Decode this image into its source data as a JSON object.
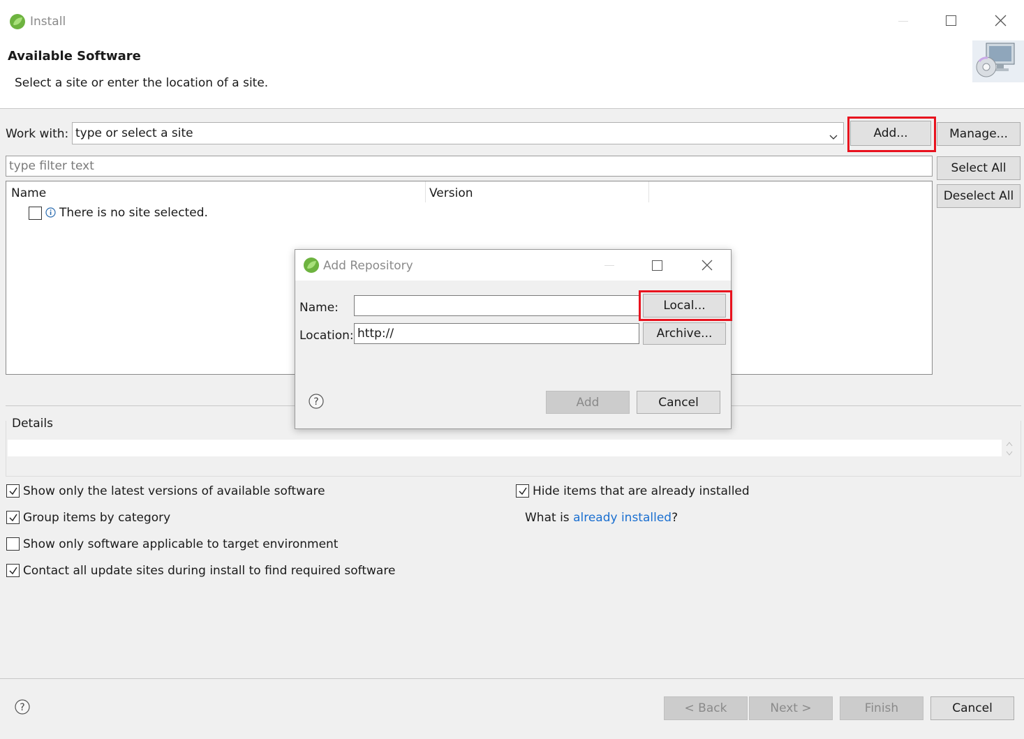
{
  "window": {
    "title": "Install",
    "icon": "spring-leaf-icon"
  },
  "header": {
    "title": "Available Software",
    "subtitle": "Select a site or enter the location of a site."
  },
  "work_with": {
    "label": "Work with:",
    "value": "type or select a site",
    "add_label": "Add...",
    "manage_label": "Manage..."
  },
  "filter": {
    "placeholder": "type filter text"
  },
  "side_buttons": {
    "select_all": "Select All",
    "deselect_all": "Deselect All"
  },
  "table": {
    "columns": [
      "Name",
      "Version"
    ],
    "rows": [
      {
        "checked": false,
        "icon": "info-icon",
        "text": "There is no site selected."
      }
    ]
  },
  "details": {
    "label": "Details"
  },
  "options": {
    "show_latest": {
      "label": "Show only the latest versions of available software",
      "checked": true
    },
    "group_by_category": {
      "label": "Group items by category",
      "checked": true
    },
    "target_env": {
      "label": "Show only software applicable to target environment",
      "checked": false
    },
    "contact_sites": {
      "label": "Contact all update sites during install to find required software",
      "checked": true
    },
    "hide_installed": {
      "label": "Hide items that are already installed",
      "checked": true
    },
    "what_is_prefix": "What is ",
    "what_is_link": "already installed",
    "what_is_suffix": "?"
  },
  "footer": {
    "back": "< Back",
    "next": "Next >",
    "finish": "Finish",
    "cancel": "Cancel"
  },
  "dialog": {
    "title": "Add Repository",
    "name_label": "Name:",
    "name_value": "",
    "location_label": "Location:",
    "location_value": "http://",
    "local_label": "Local...",
    "archive_label": "Archive...",
    "add_label": "Add",
    "cancel_label": "Cancel"
  },
  "colors": {
    "highlight": "#e8121e",
    "link": "#1a6fd0"
  }
}
